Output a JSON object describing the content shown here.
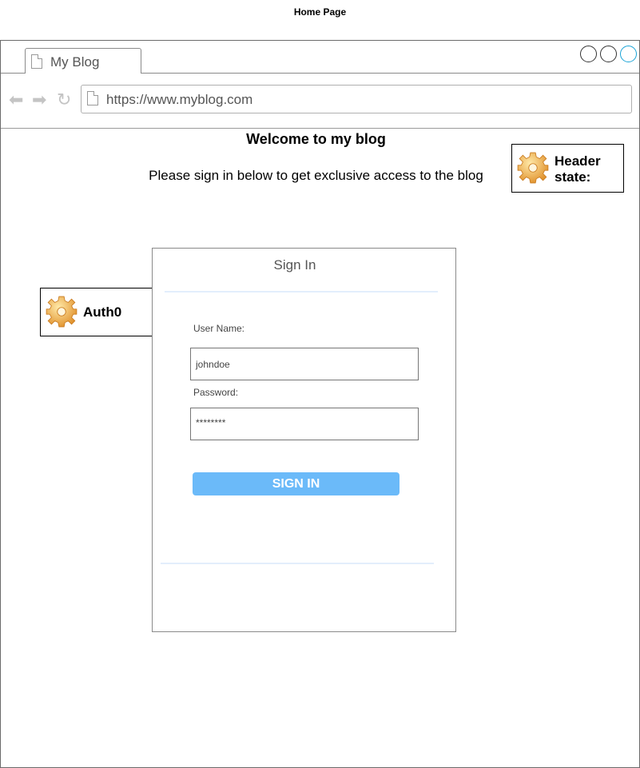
{
  "page": {
    "caption": "Home Page"
  },
  "browser": {
    "tab_title": "My Blog",
    "url": "https://www.myblog.com"
  },
  "content": {
    "title": "Welcome to my blog",
    "subtitle": "Please sign in below to get exclusive access to the blog"
  },
  "notes": {
    "header_state": "Header state:",
    "auth": "Auth0"
  },
  "signin": {
    "title": "Sign In",
    "username_label": "User Name:",
    "username_value": "johndoe",
    "password_label": "Password:",
    "password_value": "********",
    "button_label": "SIGN IN"
  },
  "colors": {
    "button": "#6bbaf9",
    "separator": "#e3eefc",
    "window_max": "#1aa3d6"
  }
}
